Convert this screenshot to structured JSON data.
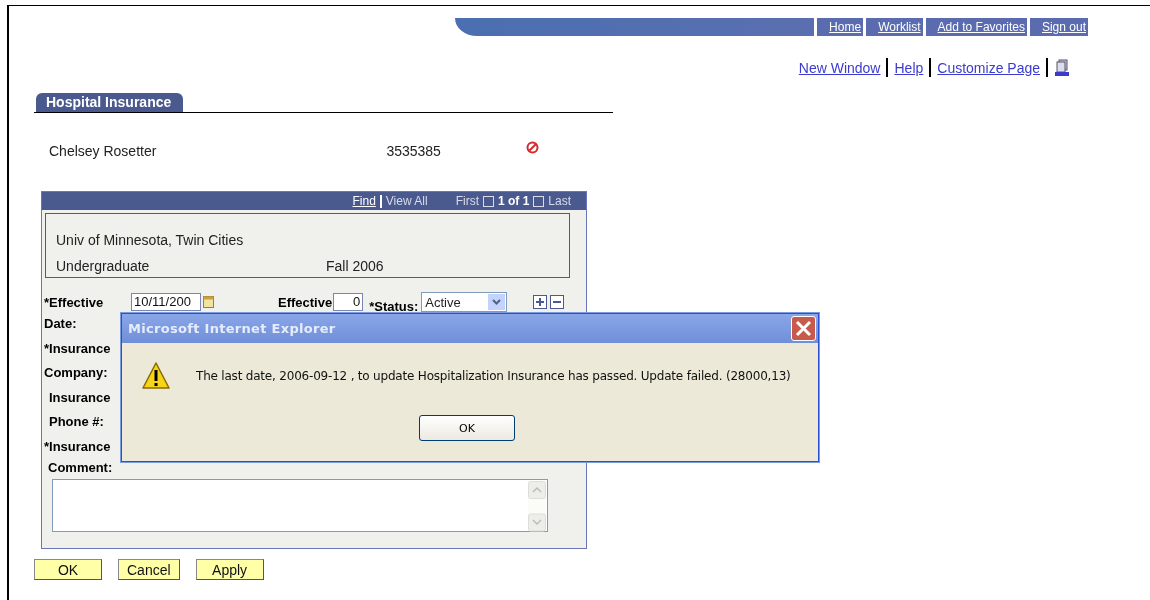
{
  "header_nav": [
    "Home",
    "Worklist",
    "Add to Favorites",
    "Sign out"
  ],
  "toolbar_links": [
    "New Window",
    "Help",
    "Customize Page"
  ],
  "tab": {
    "label": "Hospital Insurance"
  },
  "student": {
    "name": "Chelsey Rosetter",
    "id": "3535385"
  },
  "grid": {
    "find": "Find",
    "view_all": "View All",
    "first": "First",
    "count": "1 of 1",
    "last": "Last",
    "institution": "Univ of Minnesota, Twin Cities",
    "career": "Undergraduate",
    "term": "Fall 2006"
  },
  "form": {
    "date_label": "*Effective",
    "date_value": "10/11/200",
    "seq_label": "Effective",
    "seq_value": "0",
    "status_label": "*Status:",
    "status_value": "Active",
    "labels": [
      "Date:",
      "*Insurance",
      "Company:",
      "Insurance",
      "Phone #:",
      "*Insurance"
    ],
    "comment_label": "Comment:"
  },
  "buttons": [
    "OK",
    "Cancel",
    "Apply"
  ],
  "dialog": {
    "title": "Microsoft Internet Explorer",
    "message": "The last date, 2006-09-12 , to update Hospitalization Insurance has passed. Update failed. (28000,13)",
    "button": "OK"
  }
}
